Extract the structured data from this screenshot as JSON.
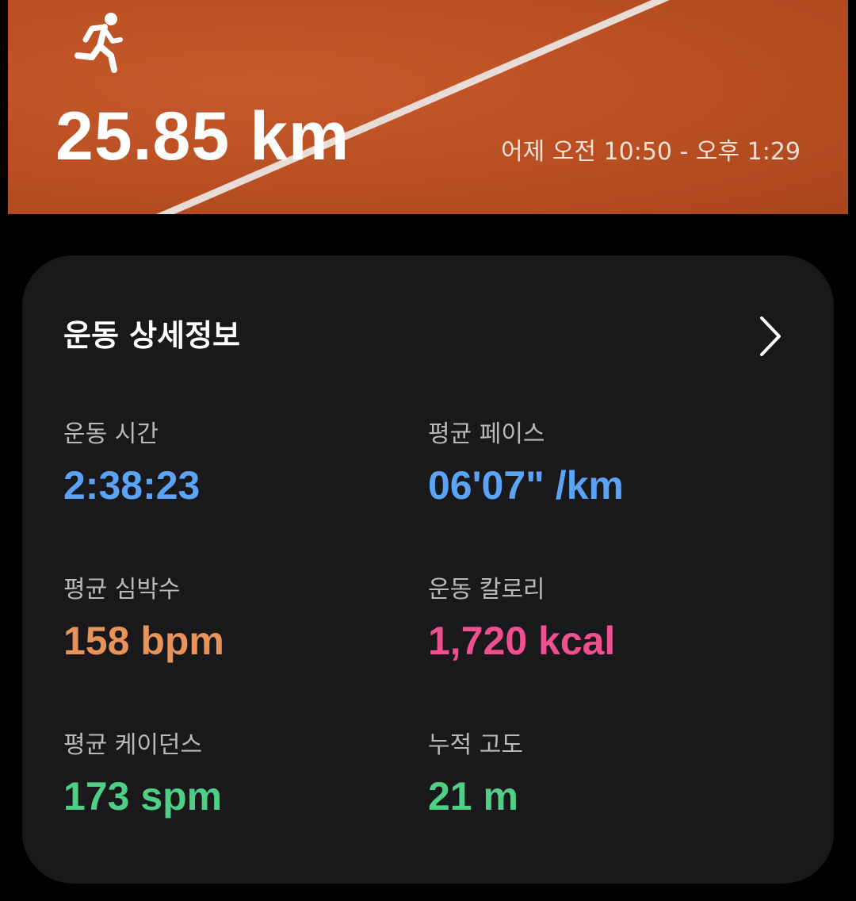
{
  "header": {
    "activity_icon": "running-person-icon",
    "distance": "25.85 km",
    "time_range": "어제 오전 10:50 - 오후 1:29",
    "colors": {
      "track": "#b94f22",
      "lane_line": "#e9dcd6"
    }
  },
  "details": {
    "title": "운동 상세정보",
    "chevron_icon": "chevron-right-icon",
    "metrics": [
      {
        "label": "운동 시간",
        "value": "2:38:23",
        "color": "#5aa3f5"
      },
      {
        "label": "평균 페이스",
        "value": "06'07\" /km",
        "color": "#5aa3f5"
      },
      {
        "label": "평균 심박수",
        "value": "158 bpm",
        "color": "#e8935a"
      },
      {
        "label": "운동 칼로리",
        "value": "1,720 kcal",
        "color": "#f0508f"
      },
      {
        "label": "평균 케이던스",
        "value": "173 spm",
        "color": "#4fce86"
      },
      {
        "label": "누적 고도",
        "value": "21 m",
        "color": "#4fce86"
      }
    ]
  }
}
